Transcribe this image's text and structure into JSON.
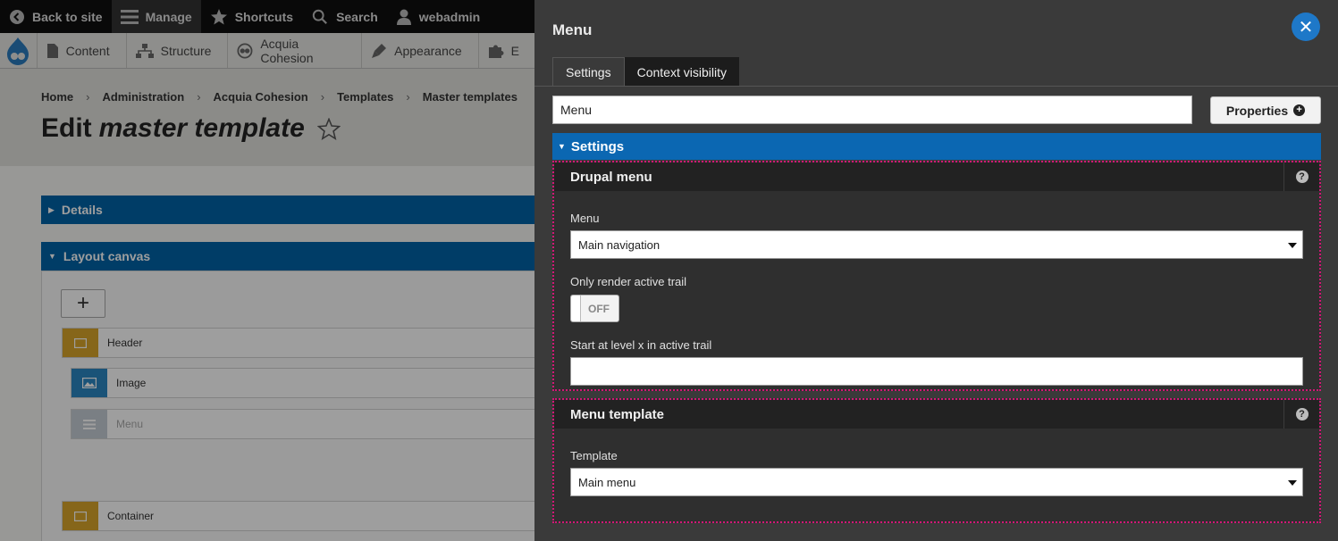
{
  "toolbar": {
    "items": [
      {
        "label": "Back to site",
        "icon": "back-arrow-icon"
      },
      {
        "label": "Manage",
        "icon": "hamburger-icon"
      },
      {
        "label": "Shortcuts",
        "icon": "star-icon"
      },
      {
        "label": "Search",
        "icon": "search-icon"
      },
      {
        "label": "webadmin",
        "icon": "user-icon"
      }
    ]
  },
  "subnav": {
    "items": [
      {
        "label": "Content",
        "icon": "page-icon"
      },
      {
        "label": "Structure",
        "icon": "structure-icon"
      },
      {
        "label": "Acquia Cohesion",
        "icon": "cohesion-icon"
      },
      {
        "label": "Appearance",
        "icon": "brush-icon"
      },
      {
        "label": "E",
        "icon": "puzzle-icon"
      }
    ]
  },
  "breadcrumb": [
    "Home",
    "Administration",
    "Acquia Cohesion",
    "Templates",
    "Master templates"
  ],
  "page": {
    "title_prefix": "Edit",
    "title_emph": "master template"
  },
  "sections": {
    "details": "Details",
    "layout_canvas": "Layout canvas"
  },
  "canvas": {
    "add_label": "+",
    "components": [
      {
        "label": "Header",
        "color": "#d8a52a"
      },
      {
        "label": "Image",
        "color": "#2a86c2"
      },
      {
        "label": "Menu",
        "color": "#c5ced6"
      },
      {
        "label": "Container",
        "color": "#d8a52a"
      }
    ]
  },
  "panel": {
    "title": "Menu",
    "close_label": "✕",
    "tabs": [
      {
        "label": "Settings",
        "active": true
      },
      {
        "label": "Context visibility",
        "active": false
      }
    ],
    "name_value": "Menu",
    "properties_label": "Properties",
    "settings_label": "Settings",
    "groups": {
      "drupal_menu": {
        "title": "Drupal menu",
        "menu_label": "Menu",
        "menu_value": "Main navigation",
        "active_trail_label": "Only render active trail",
        "toggle_label": "OFF",
        "level_label": "Start at level x in active trail",
        "level_value": ""
      },
      "menu_template": {
        "title": "Menu template",
        "template_label": "Template",
        "template_value": "Main menu"
      }
    }
  },
  "colors": {
    "accent_blue": "#0b67b2",
    "highlight_dotted": "#d11876",
    "close_button": "#1e78c8"
  }
}
